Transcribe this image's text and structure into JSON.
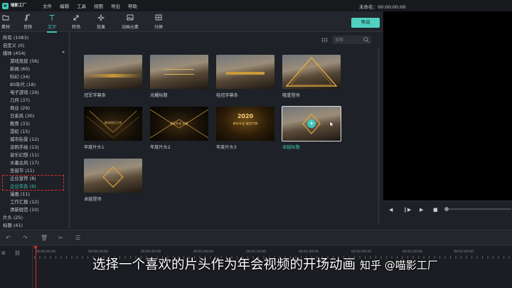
{
  "app": {
    "logo_text": "喵影工厂",
    "project_name": "未命名：00:00:00:00"
  },
  "menu": [
    "文件",
    "编辑",
    "工具",
    "视图",
    "导出",
    "帮助"
  ],
  "toolbar": {
    "tabs": [
      {
        "label": "素材",
        "icon": "folder-icon"
      },
      {
        "label": "音频",
        "icon": "music-icon"
      },
      {
        "label": "文字",
        "icon": "text-icon",
        "active": true
      },
      {
        "label": "转场",
        "icon": "transition-icon"
      },
      {
        "label": "效果",
        "icon": "effects-icon"
      },
      {
        "label": "动画元素",
        "icon": "image-icon"
      },
      {
        "label": "分屏",
        "icon": "split-screen-icon"
      }
    ],
    "export_label": "导出"
  },
  "sidebar": {
    "items": [
      {
        "label": "所有 (1083)"
      },
      {
        "label": "自定义 (0)"
      },
      {
        "label": "媒体 (454)"
      },
      {
        "label": "游戏竞技 (56)"
      },
      {
        "label": "新闻 (60)"
      },
      {
        "label": "科幻 (34)"
      },
      {
        "label": "80年代 (18)"
      },
      {
        "label": "电子游戏 (19)"
      },
      {
        "label": "几何 (37)"
      },
      {
        "label": "商业 (29)"
      },
      {
        "label": "日系风 (30)"
      },
      {
        "label": "教育 (33)"
      },
      {
        "label": "霓虹 (15)"
      },
      {
        "label": "城市街景 (12)"
      },
      {
        "label": "涂鸦手绘 (13)"
      },
      {
        "label": "音乐幻想 (11)"
      },
      {
        "label": "水墨古风 (17)"
      },
      {
        "label": "圣诞节 (11)"
      },
      {
        "label": "企业宣传 (8)"
      },
      {
        "label": "企业年会 (9)",
        "selected": true
      },
      {
        "label": "漫画 (11)"
      },
      {
        "label": "工作汇报 (12)"
      },
      {
        "label": "清新假范 (10)"
      },
      {
        "label": "片头 (25)"
      },
      {
        "label": "标题 (41)"
      }
    ]
  },
  "search": {
    "placeholder": "搜索"
  },
  "templates": [
    {
      "name": "冠军字幕条"
    },
    {
      "name": "光耀标题"
    },
    {
      "name": "桂冠字幕条"
    },
    {
      "name": "隆重登场"
    },
    {
      "name": "年度片头1",
      "overlay": "新年快乐工作"
    },
    {
      "name": "年度片头2",
      "overlay": "新年年会 年度"
    },
    {
      "name": "年度片头3",
      "overlay": "2020",
      "overlay2": "新年年会 盛世华典"
    },
    {
      "name": "卓越标题",
      "selected": true
    },
    {
      "name": "卓越登场"
    }
  ],
  "player": {
    "controls": [
      "prev-frame",
      "play-icon",
      "stop-icon"
    ]
  },
  "timeline": {
    "ticks": [
      "00:00:00:00",
      "00:00:20:00",
      "00:00:40:00",
      "00:01:00:00",
      "00:01:20:00",
      "00:01:40:00",
      "00:02:00:00",
      "00:02:20:00",
      "00:02:40:00"
    ]
  },
  "subtitle": "选择一个喜欢的片头作为年会视频的开场动画",
  "watermark": "知乎 @喵影工厂",
  "colors": {
    "accent": "#3ec5b5",
    "highlight": "#d92d2d",
    "export_button": "#4fd1c1"
  }
}
